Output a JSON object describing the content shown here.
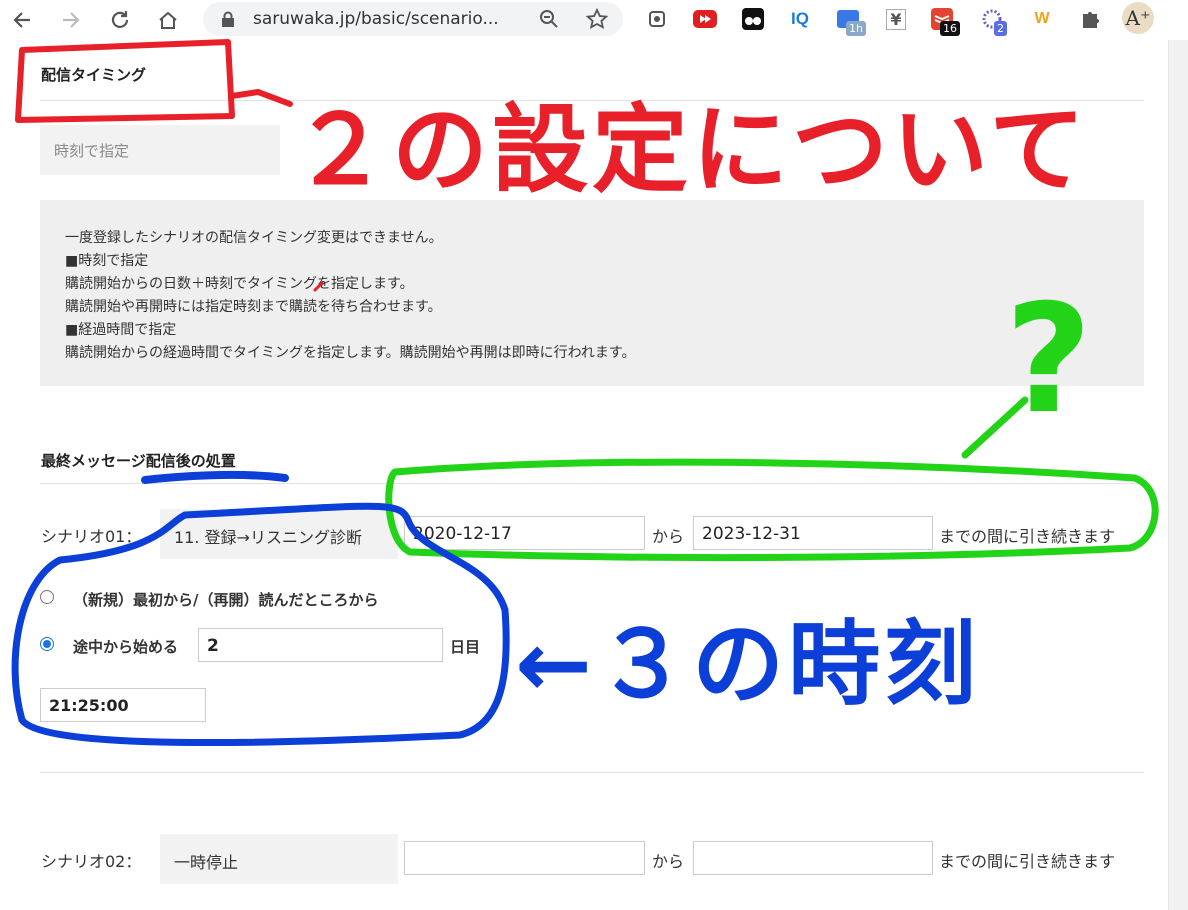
{
  "browser": {
    "url": "saruwaka.jp/basic/scenario...",
    "extensions": [
      {
        "name": "1h"
      },
      {
        "name": "16"
      },
      {
        "name": "2"
      }
    ]
  },
  "delivery_timing": {
    "heading": "配信タイミング",
    "mode_value": "時刻で指定",
    "notice_lines": [
      "一度登録したシナリオの配信タイミング変更はできません。",
      "■時刻で指定",
      "購読開始からの日数＋時刻でタイミングを指定します。",
      "購読開始や再開時には指定時刻まで購読を待ち合わせます。",
      "■経過時間で指定",
      "購読開始からの経過時間でタイミングを指定します。購読開始や再開は即時に行われます。"
    ]
  },
  "after_last": {
    "heading": "最終メッセージ配信後の処置",
    "scenario01": {
      "label": "シナリオ01：",
      "name": "11. 登録→リスニング診断",
      "date_from": "2020-12-17",
      "kara": "から",
      "date_to": "2023-12-31",
      "suffix": "までの間に引き続きます",
      "option1": "（新規）最初から/（再開）読んだところから",
      "option2": "途中から始める",
      "day_value": "2",
      "day_unit": "日目",
      "time_value": "21:25:00"
    },
    "scenario02": {
      "label": "シナリオ02：",
      "name": "一時停止",
      "date_from": "",
      "kara": "から",
      "date_to": "",
      "suffix": "までの間に引き続きます"
    }
  },
  "annotations": {
    "red_text": "２の設定について",
    "green_text": "?",
    "blue_text": "←３の時刻"
  },
  "colors": {
    "red": "#e8202a",
    "green": "#22d318",
    "blue": "#0b3fd8"
  }
}
